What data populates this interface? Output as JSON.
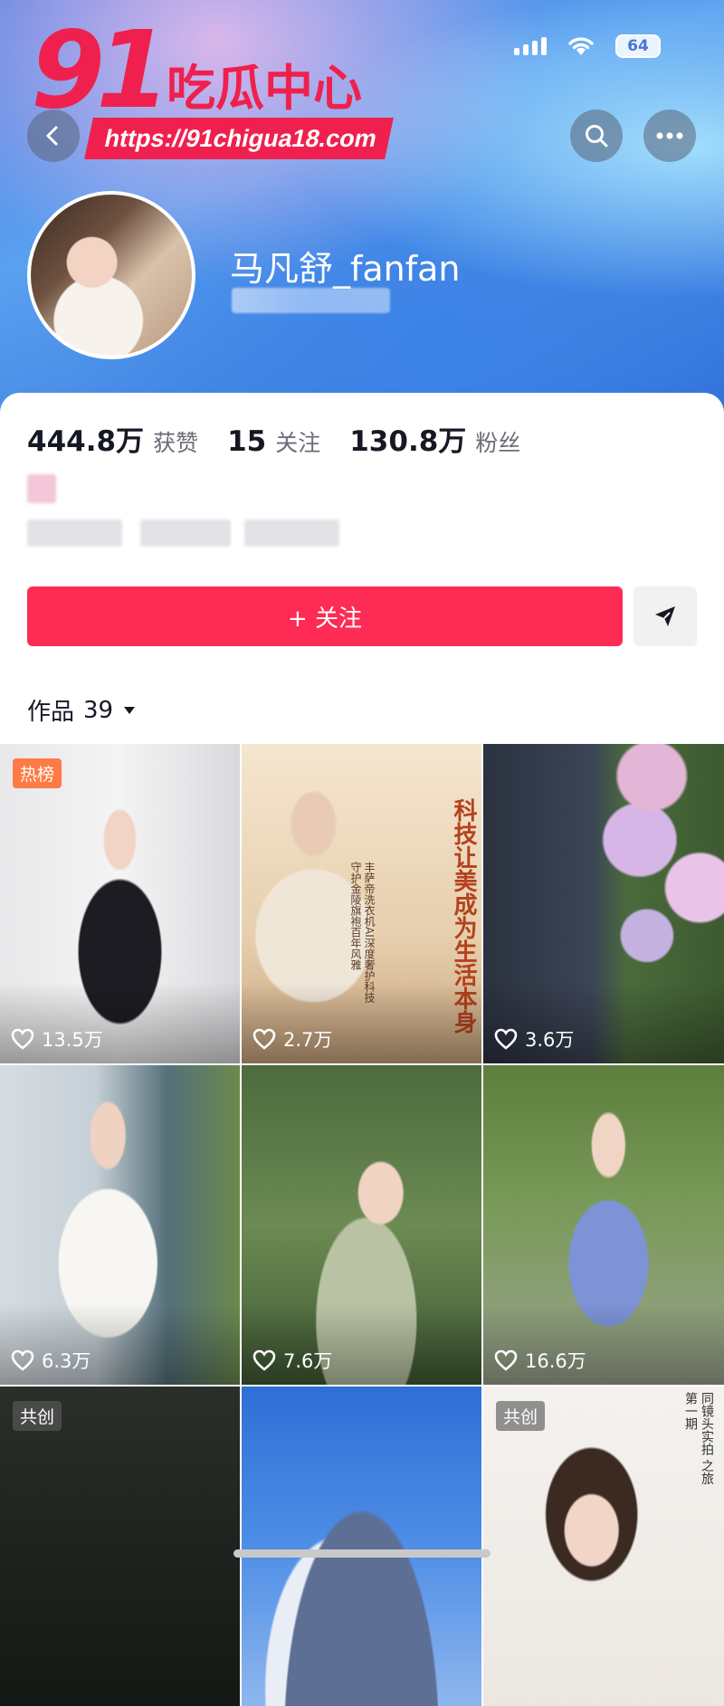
{
  "status": {
    "battery": "64"
  },
  "watermark": {
    "number": "91",
    "text": "吃瓜中心",
    "url": "https://91chigua18.com"
  },
  "profile": {
    "username": "马凡舒_fanfan"
  },
  "stats": [
    {
      "value": "444.8万",
      "label": "获赞"
    },
    {
      "value": "15",
      "label": "关注"
    },
    {
      "value": "130.8万",
      "label": "粉丝"
    }
  ],
  "actions": {
    "follow": "+ 关注"
  },
  "works": {
    "label": "作品",
    "count": "39"
  },
  "videos": [
    {
      "likes": "13.5万",
      "tag": "热榜"
    },
    {
      "likes": "2.7万",
      "tag": "",
      "poster_text": [
        "科技让美",
        "成为生活本身"
      ],
      "poster_sub": "丰萨帝洗衣机AI深度奢护科技 守护金陵旗袍百年风雅"
    },
    {
      "likes": "3.6万",
      "tag": ""
    },
    {
      "likes": "6.3万",
      "tag": ""
    },
    {
      "likes": "7.6万",
      "tag": ""
    },
    {
      "likes": "16.6万",
      "tag": ""
    },
    {
      "likes": "",
      "tag": "共创"
    },
    {
      "likes": "",
      "tag": ""
    },
    {
      "likes": "",
      "tag": "共创",
      "side_text": "同镜头实拍 之旅 第一期"
    }
  ],
  "colors": {
    "accent": "#fe2c55",
    "hot_tag": "#ff7a45"
  }
}
